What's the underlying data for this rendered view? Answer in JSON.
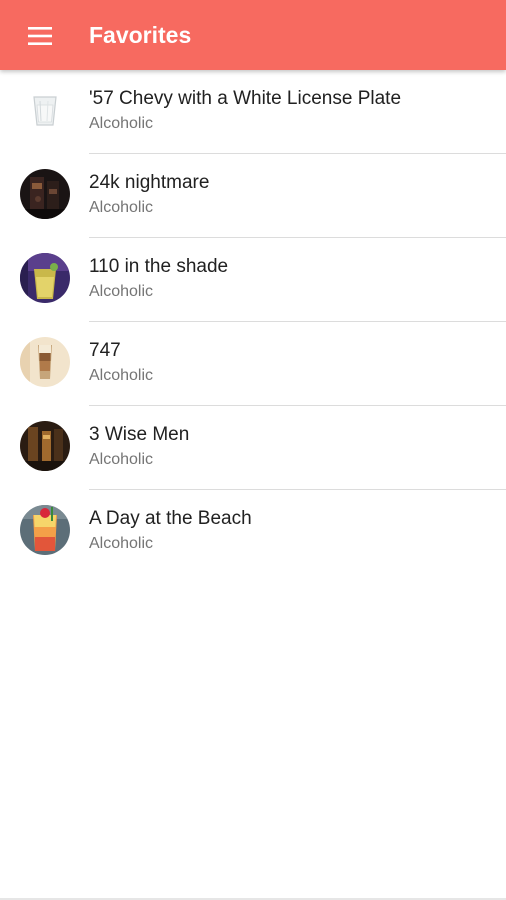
{
  "app_bar": {
    "title": "Favorites",
    "menu_icon": "hamburger-menu-icon",
    "color": "#f76a60"
  },
  "favorites": [
    {
      "name": "'57 Chevy with a White License Plate",
      "category": "Alcoholic"
    },
    {
      "name": "24k nightmare",
      "category": "Alcoholic"
    },
    {
      "name": "110 in the shade",
      "category": "Alcoholic"
    },
    {
      "name": "747",
      "category": "Alcoholic"
    },
    {
      "name": "3 Wise Men",
      "category": "Alcoholic"
    },
    {
      "name": "A Day at the Beach",
      "category": "Alcoholic"
    }
  ]
}
